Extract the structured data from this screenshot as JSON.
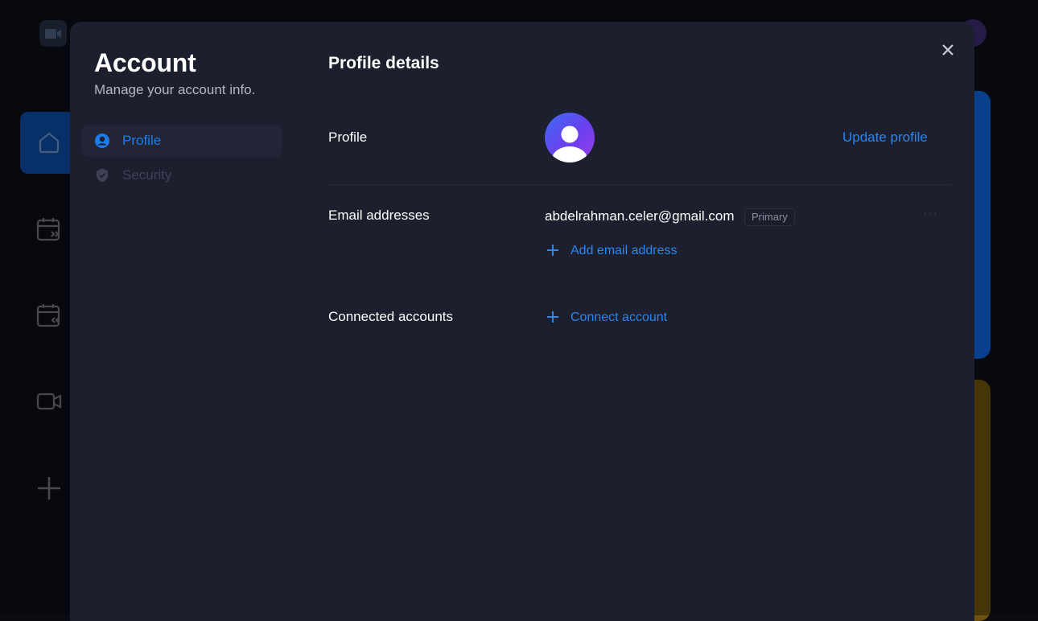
{
  "account": {
    "title": "Account",
    "subtitle": "Manage your account info."
  },
  "nav": {
    "items": [
      {
        "label": "Profile",
        "icon": "user-circle-icon",
        "active": true
      },
      {
        "label": "Security",
        "icon": "shield-icon",
        "active": false
      }
    ]
  },
  "profile_details": {
    "title": "Profile details",
    "profile": {
      "label": "Profile",
      "update_label": "Update profile"
    },
    "email": {
      "label": "Email addresses",
      "address": "abdelrahman.celer@gmail.com",
      "badge": "Primary",
      "more": "···",
      "add_label": "Add email address"
    },
    "connected": {
      "label": "Connected accounts",
      "connect_label": "Connect account"
    }
  },
  "colors": {
    "accent": "#2a86f2",
    "modal_bg": "#1c1f2e",
    "page_bg": "#0d0e16"
  }
}
